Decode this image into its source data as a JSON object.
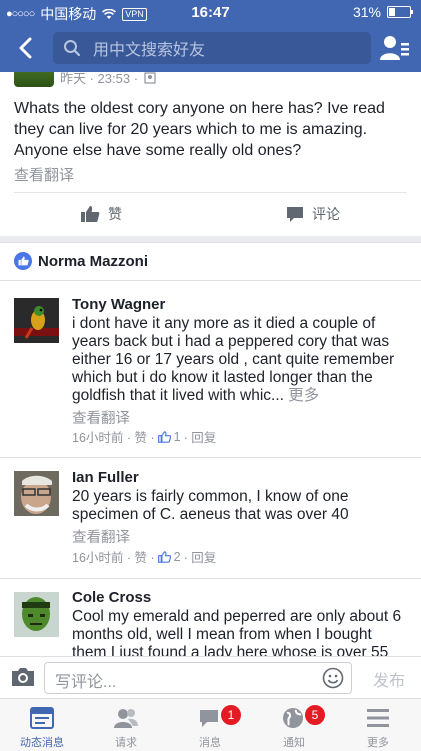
{
  "status_bar": {
    "carrier": "中国移动",
    "signal": "●○○○○",
    "vpn": "VPN",
    "time": "16:47",
    "battery": "31%"
  },
  "header": {
    "search_placeholder": "用中文搜索好友"
  },
  "post": {
    "timestamp": "昨天 · 23:53 ·",
    "text": "Whats the oldest cory anyone on here has? Ive read they can live for 20 years which to me is amazing. Anyone else have some really old ones?",
    "translate": "查看翻译",
    "like_label": "赞",
    "comment_label": "评论"
  },
  "liker": {
    "name": "Norma Mazzoni"
  },
  "comments": [
    {
      "name": "Tony Wagner",
      "text": "i dont have it any more as it died a couple of years back but i had a peppered cory that was either 16 or 17 years old , cant quite remember which but i do know it lasted longer than the goldfish that it lived with whic...",
      "more": "更多",
      "translate": "查看翻译",
      "time": "16小时前 · 赞 ·",
      "likes": "1",
      "reply": "· 回复"
    },
    {
      "name": "Ian Fuller",
      "text": "20 years is fairly common, I  know of one specimen of C. aeneus that was over 40",
      "translate": "查看翻译",
      "time": "16小时前 · 赞 ·",
      "likes": "2",
      "reply": "· 回复"
    },
    {
      "name": "Cole Cross",
      "text": "Cool my emerald and peperred are only about 6 months old, well I mean from when I bought them I just found a lady here whose is over 55"
    }
  ],
  "composer": {
    "placeholder": "写评论...",
    "publish": "发布"
  },
  "tabbar": [
    {
      "label": "动态消息",
      "icon": "news-feed-icon",
      "active": true
    },
    {
      "label": "请求",
      "icon": "friend-requests-icon"
    },
    {
      "label": "消息",
      "icon": "messages-icon",
      "badge": "1"
    },
    {
      "label": "通知",
      "icon": "notifications-globe-icon",
      "badge": "5"
    },
    {
      "label": "更多",
      "icon": "menu-icon"
    }
  ],
  "colors": {
    "brand": "#4267b2",
    "badge": "#e41b23",
    "muted": "#90949c"
  }
}
